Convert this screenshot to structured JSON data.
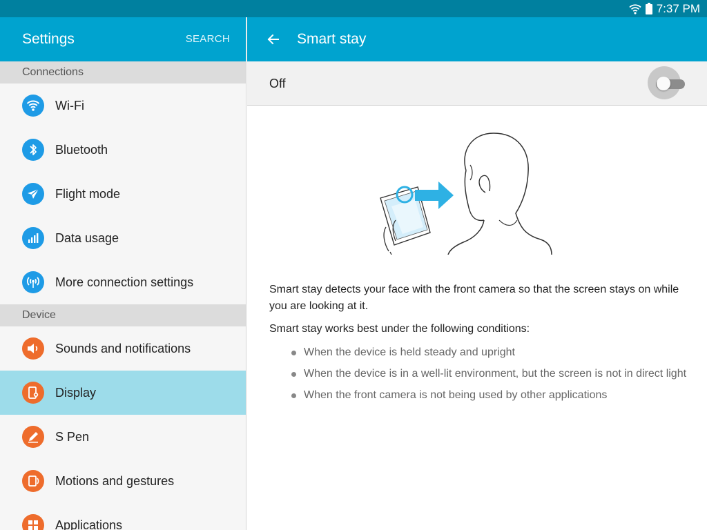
{
  "status_bar": {
    "time": "7:37 PM",
    "icons": [
      "wifi-icon",
      "battery-icon"
    ]
  },
  "settings_panel": {
    "title": "Settings",
    "search_label": "SEARCH",
    "sections": [
      {
        "header": "Connections",
        "items": [
          {
            "label": "Wi-Fi",
            "icon": "wifi-icon",
            "color": "#1e9be6"
          },
          {
            "label": "Bluetooth",
            "icon": "bluetooth-icon",
            "color": "#1e9be6"
          },
          {
            "label": "Flight mode",
            "icon": "airplane-icon",
            "color": "#1e9be6"
          },
          {
            "label": "Data usage",
            "icon": "data-usage-icon",
            "color": "#1e9be6"
          },
          {
            "label": "More connection settings",
            "icon": "connection-icon",
            "color": "#1e9be6"
          }
        ]
      },
      {
        "header": "Device",
        "items": [
          {
            "label": "Sounds and notifications",
            "icon": "speaker-icon",
            "color": "#ee6c2c"
          },
          {
            "label": "Display",
            "icon": "display-icon",
            "color": "#ee6c2c",
            "selected": true
          },
          {
            "label": "S Pen",
            "icon": "pen-icon",
            "color": "#ee6c2c"
          },
          {
            "label": "Motions and gestures",
            "icon": "motions-icon",
            "color": "#ee6c2c"
          },
          {
            "label": "Applications",
            "icon": "applications-icon",
            "color": "#ee6c2c"
          }
        ]
      }
    ]
  },
  "detail_panel": {
    "title": "Smart stay",
    "toggle": {
      "state_label": "Off",
      "on": false
    },
    "description": "Smart stay detects your face with the front camera so that the screen stays on while you are looking at it.",
    "conditions_title": "Smart stay works best under the following conditions:",
    "conditions": [
      "When the device is held steady and upright",
      "When the device is in a well-lit environment, but the screen is not in direct light",
      "When the front camera is not being used by other applications"
    ]
  },
  "colors": {
    "header": "#00a3cf",
    "status_bar": "#00809f",
    "selected_row": "#9ddcea",
    "connections_icon": "#1e9be6",
    "device_icon": "#ee6c2c",
    "illustration_accent": "#2eb1e4"
  }
}
